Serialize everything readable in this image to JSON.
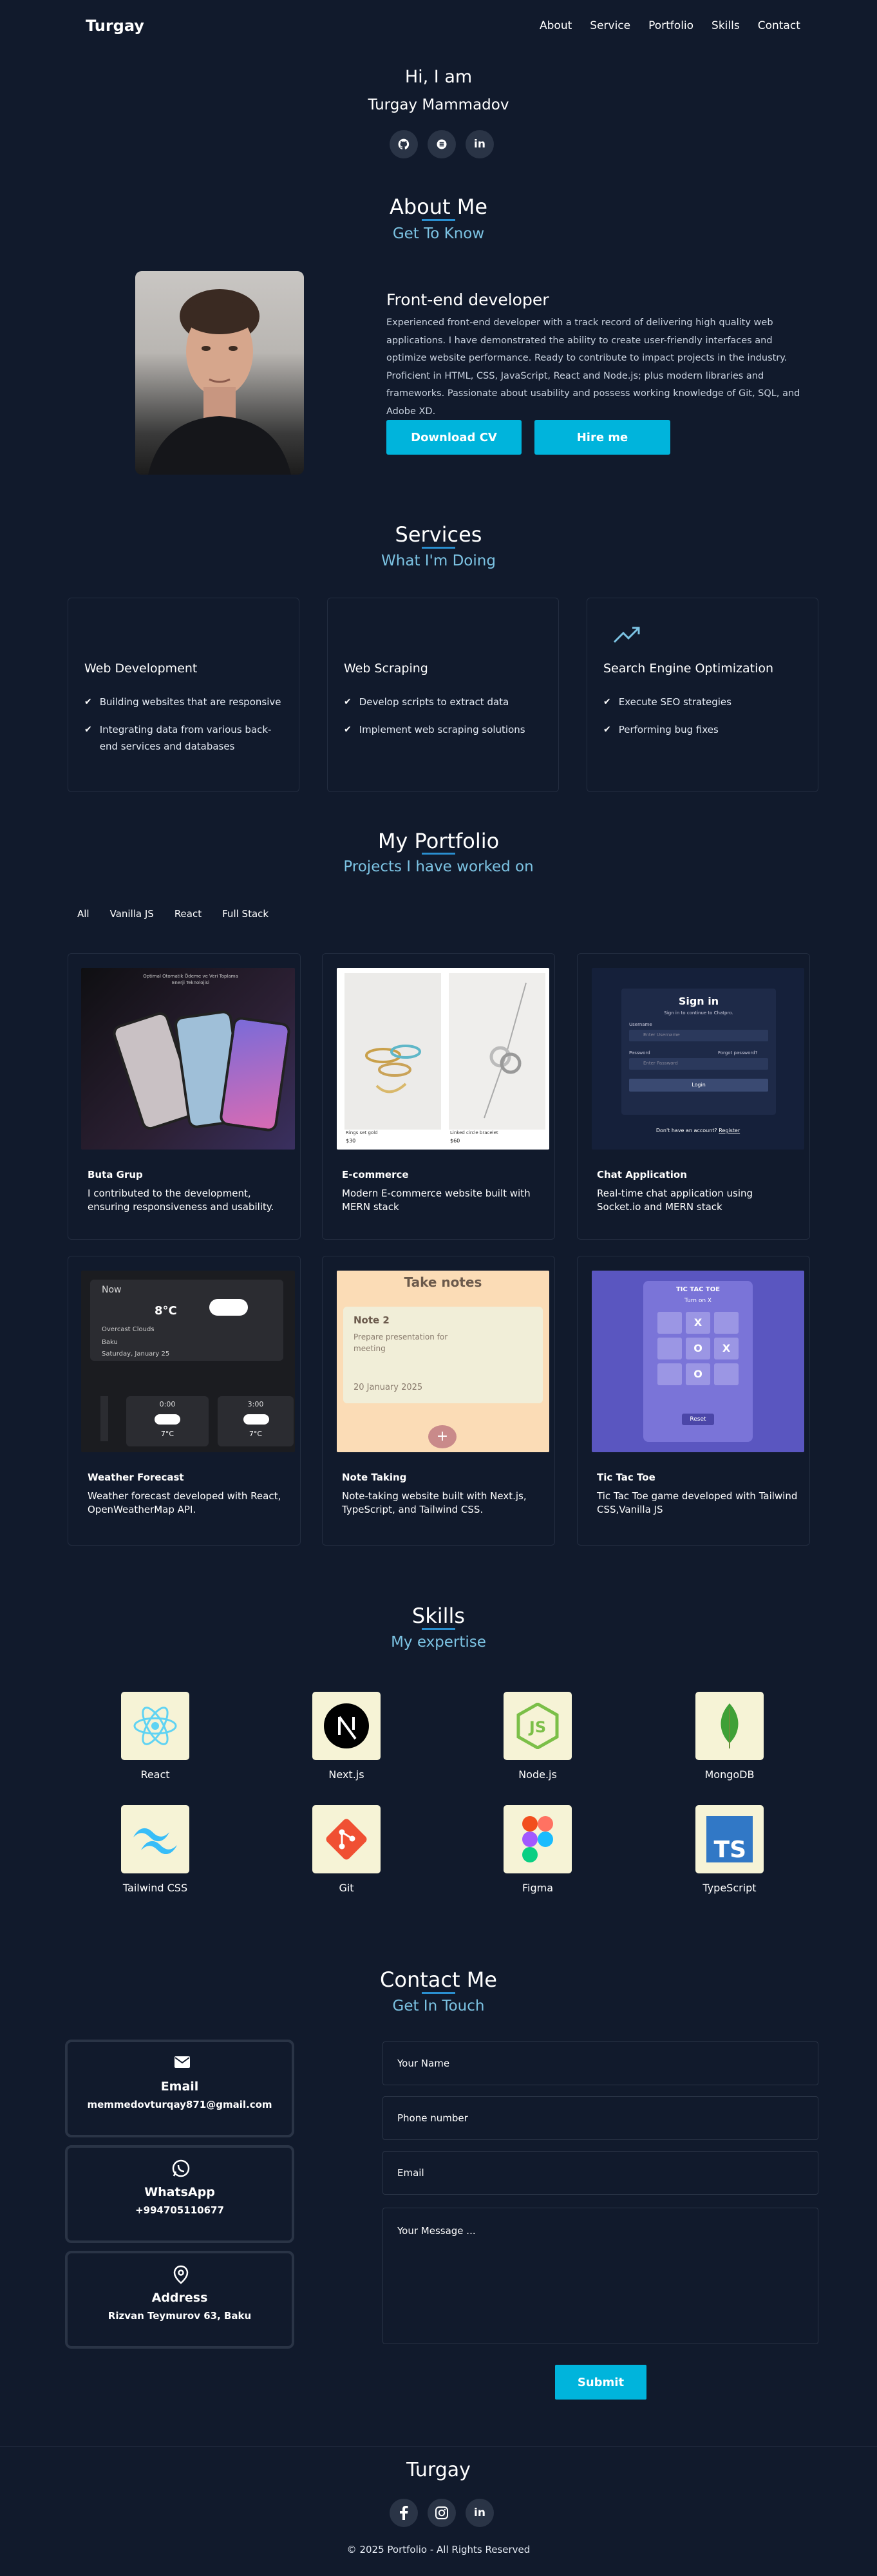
{
  "header": {
    "logo": "Turgay",
    "nav": [
      "About",
      "Service",
      "Portfolio",
      "Skills",
      "Contact"
    ]
  },
  "hero": {
    "greeting": "Hi, I am",
    "name": "Turgay Mammadov",
    "socials": [
      "github-icon",
      "stackoverflow-icon",
      "linkedin-icon"
    ]
  },
  "about": {
    "title": "About Me",
    "subtitle": "Get To Know",
    "role": "Front-end developer",
    "bio": "Experienced front-end developer with a track record of delivering high quality web applications. I have demonstrated the ability to create user-friendly interfaces and optimize website performance. Ready to contribute to impact projects in the industry. Proficient in HTML, CSS, JavaScript, React and Node.js; plus modern libraries and frameworks. Passionate about usability and possess working knowledge of Git, SQL, and Adobe XD.",
    "download_cv": "Download CV",
    "hire_me": "Hire me"
  },
  "services": {
    "title": "Services",
    "subtitle": "What I'm Doing",
    "cards": [
      {
        "title": "Web Development",
        "items": [
          "Building websites that are responsive",
          "Integrating data from various back-end services and databases"
        ]
      },
      {
        "title": "Web Scraping",
        "items": [
          "Develop scripts to extract data",
          "Implement web scraping solutions"
        ]
      },
      {
        "title": "Search Engine Optimization",
        "items": [
          "Execute SEO strategies",
          "Performing bug fixes"
        ]
      }
    ]
  },
  "portfolio": {
    "title": "My Portfolio",
    "subtitle": "Projects I have worked on",
    "tabs": [
      "All",
      "Vanilla JS",
      "React",
      "Full Stack"
    ],
    "projects": [
      {
        "title": "Buta Grup",
        "desc": "I contributed to the development, ensuring responsiveness and usability."
      },
      {
        "title": "E-commerce",
        "desc": "Modern E-commerce website built with MERN stack"
      },
      {
        "title": "Chat Application",
        "desc": "Real-time chat application using Socket.io and MERN stack"
      },
      {
        "title": "Weather Forecast",
        "desc": "Weather forecast developed with React, OpenWeatherMap API."
      },
      {
        "title": "Note Taking",
        "desc": "Note-taking website built with Next.js, TypeScript, and Tailwind CSS."
      },
      {
        "title": "Tic Tac Toe",
        "desc": "Tic Tac Toe game developed with Tailwind CSS,Vanilla JS"
      }
    ],
    "thumbs": {
      "buta_text": "Optimal Otomatik Ödeme ve Veri Toplama Enerji Teknolojisi",
      "ecom_left_caption": "Rings set gold",
      "ecom_left_price": "$30",
      "ecom_right_caption": "Linked circle bracelet",
      "ecom_right_price": "$60",
      "chat_heading": "Sign in",
      "chat_sub": "Sign in to continue to Chatpro.",
      "chat_username_label": "Username",
      "chat_username_ph": "Enter Username",
      "chat_password_label": "Password",
      "chat_forgot": "Forgot password?",
      "chat_password_ph": "Enter Password",
      "chat_login": "Login",
      "chat_footer": "Don't have an account?",
      "chat_register": "Register",
      "weather_now": "Now",
      "weather_temp": "8°C",
      "weather_desc": "Overcast Clouds",
      "weather_city": "Baku",
      "weather_date": "Saturday, January 25",
      "weather_t1_time": "0:00",
      "weather_t1_temp": "7°C",
      "weather_t2_time": "3:00",
      "weather_t2_temp": "7°C",
      "notes_heading": "Take notes",
      "notes_card_title": "Note 2",
      "notes_card_text": "Prepare presentation for meeting",
      "notes_card_date": "20 January 2025",
      "notes_add": "+",
      "ttt_heading": "TIC TAC TOE",
      "ttt_turn": "Turn on X",
      "ttt_cells": [
        "",
        "X",
        "",
        "",
        "O",
        "X",
        "",
        "O",
        ""
      ],
      "ttt_reset": "Reset"
    }
  },
  "skills": {
    "title": "Skills",
    "subtitle": "My expertise",
    "items": [
      {
        "name": "React",
        "icon": "react-icon"
      },
      {
        "name": "Next.js",
        "icon": "nextjs-icon"
      },
      {
        "name": "Node.js",
        "icon": "nodejs-icon"
      },
      {
        "name": "MongoDB",
        "icon": "mongodb-icon"
      },
      {
        "name": "Tailwind CSS",
        "icon": "tailwind-icon"
      },
      {
        "name": "Git",
        "icon": "git-icon"
      },
      {
        "name": "Figma",
        "icon": "figma-icon"
      },
      {
        "name": "TypeScript",
        "icon": "typescript-icon"
      }
    ]
  },
  "contact": {
    "title": "Contact Me",
    "subtitle": "Get In Touch",
    "cards": [
      {
        "label": "Email",
        "value": "memmedovturqay871@gmail.com"
      },
      {
        "label": "WhatsApp",
        "value": "+994705110677"
      },
      {
        "label": "Address",
        "value": "Rizvan Teymurov 63, Baku"
      }
    ],
    "form": {
      "name_ph": "Your Name",
      "phone_ph": "Phone number",
      "email_ph": "Email",
      "message_ph": "Your Message ...",
      "submit": "Submit"
    }
  },
  "footer": {
    "logo": "Turgay",
    "socials": [
      "facebook-icon",
      "instagram-icon",
      "linkedin-icon"
    ],
    "copyright": "© 2025 Portfolio - All Rights Reserved"
  },
  "colors": {
    "background": "#111a2c",
    "accent": "#00b4dc",
    "subtitle": "#7cc3e3",
    "skill_tile": "#f6f3d6"
  }
}
